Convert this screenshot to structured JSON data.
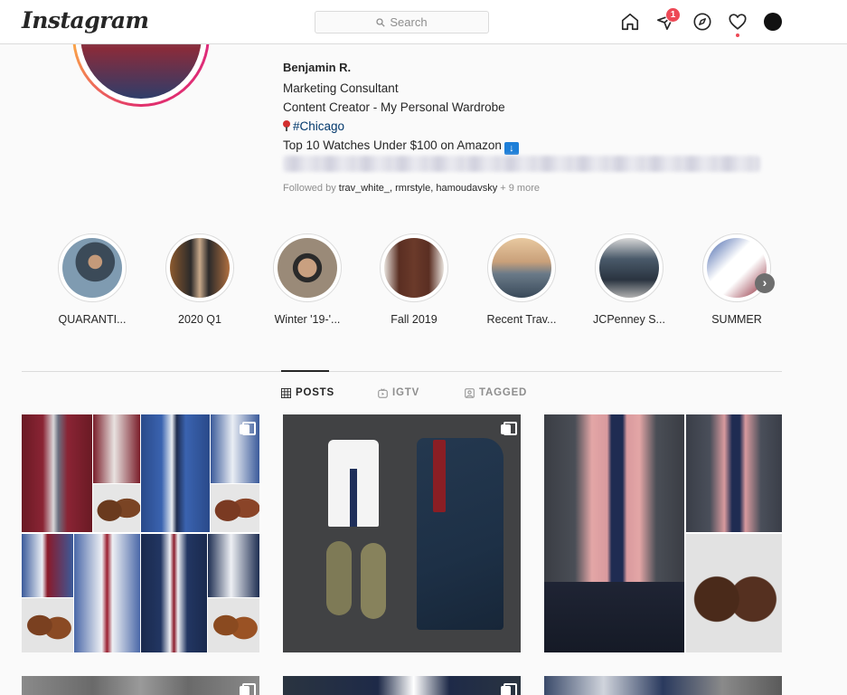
{
  "app": {
    "logo": "Instagram"
  },
  "nav": {
    "search_placeholder": "Search",
    "notification_count": "1"
  },
  "profile": {
    "name": "Benjamin R.",
    "bio_lines": [
      "Marketing Consultant",
      "Content Creator - My Personal Wardrobe"
    ],
    "location_tag": "#Chicago",
    "promo": "Top 10 Watches Under $100 on Amazon",
    "followed_prefix": "Followed by ",
    "followed_names": "trav_white_, rmrstyle, hamoudavsky",
    "followed_more": " + 9 more"
  },
  "highlights": [
    {
      "label": "QUARANTI...",
      "color": "#5d7b93"
    },
    {
      "label": "2020 Q1",
      "color": "#8c5a2e"
    },
    {
      "label": "Winter '19-'...",
      "color": "#6d5a4a"
    },
    {
      "label": "Fall 2019",
      "color": "#6b3a2a"
    },
    {
      "label": "Recent Trav...",
      "color": "#b8936a"
    },
    {
      "label": "JCPenney S...",
      "color": "#6a7a88"
    },
    {
      "label": "SUMMER",
      "color": "#3f5fa8"
    }
  ],
  "tabs": [
    {
      "label": "POSTS",
      "icon": "grid-icon",
      "active": true
    },
    {
      "label": "IGTV",
      "icon": "igtv-icon",
      "active": false
    },
    {
      "label": "TAGGED",
      "icon": "tagged-icon",
      "active": false
    }
  ],
  "colors": {
    "accent": "#ed4956",
    "link": "#00376b",
    "border": "#dbdbdb"
  }
}
